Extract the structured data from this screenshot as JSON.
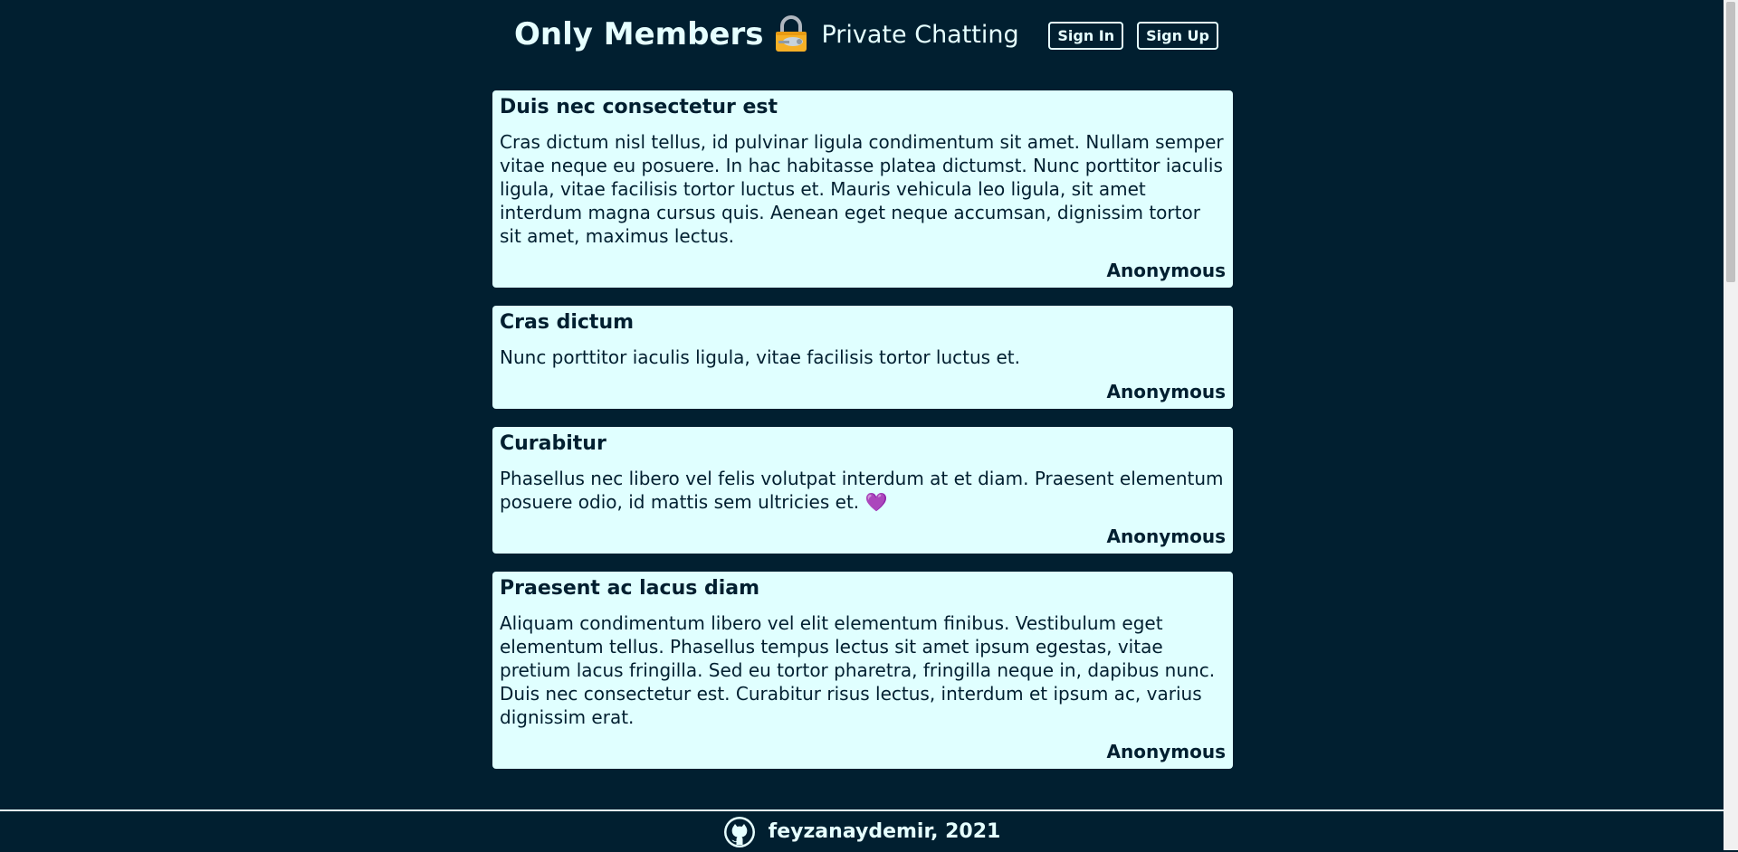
{
  "header": {
    "brand_title": "Only Members",
    "brand_subtitle": "Private Chatting",
    "lock_icon": "lock-icon",
    "sign_in_label": "Sign In",
    "sign_up_label": "Sign Up"
  },
  "messages": [
    {
      "title": "Duis nec consectetur est",
      "body": "Cras dictum nisl tellus, id pulvinar ligula condimentum sit amet. Nullam semper vitae neque eu posuere. In hac habitasse platea dictumst. Nunc porttitor iaculis ligula, vitae facilisis tortor luctus et. Mauris vehicula leo ligula, sit amet interdum magna cursus quis. Aenean eget neque accumsan, dignissim tortor sit amet, maximus lectus.",
      "author": "Anonymous"
    },
    {
      "title": "Cras dictum",
      "body": "Nunc porttitor iaculis ligula, vitae facilisis tortor luctus et.",
      "author": "Anonymous"
    },
    {
      "title": "Curabitur",
      "body": "Phasellus nec libero vel felis volutpat interdum at et diam. Praesent elementum posuere odio, id mattis sem ultricies et. 💜",
      "author": "Anonymous"
    },
    {
      "title": "Praesent ac lacus diam",
      "body": "Aliquam condimentum libero vel elit elementum finibus. Vestibulum eget elementum tellus. Phasellus tempus lectus sit amet ipsum egestas, vitae pretium lacus fringilla. Sed eu tortor pharetra, fringilla neque in, dapibus nunc. Duis nec consectetur est. Curabitur risus lectus, interdum et ipsum ac, varius dignissim erat.",
      "author": "Anonymous"
    }
  ],
  "footer": {
    "icon": "github-icon",
    "text": "feyzanaydemir, 2021"
  },
  "colors": {
    "background": "#011f30",
    "card": "#e0ffff",
    "text_light": "#e6ffff",
    "text_dark": "#011f30"
  }
}
